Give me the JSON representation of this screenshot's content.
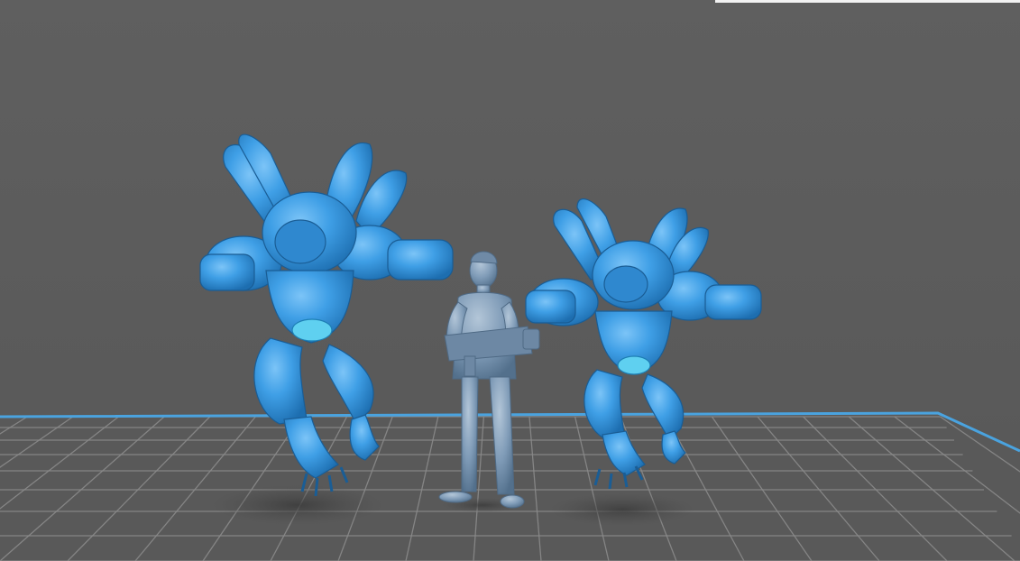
{
  "viewport": {
    "background_color": "#5d5d5d",
    "bed_grid_color": "#8a8a8a",
    "bed_border_color": "#4aa3df",
    "model_color_selected": "#3f9fe6",
    "model_color_unselected": "#7c9ab8"
  },
  "scene": {
    "models": [
      {
        "role": "winged-alien-creature",
        "selected": true
      },
      {
        "role": "human-figure-with-rifle",
        "selected": false
      },
      {
        "role": "winged-alien-creature",
        "selected": true
      }
    ]
  }
}
